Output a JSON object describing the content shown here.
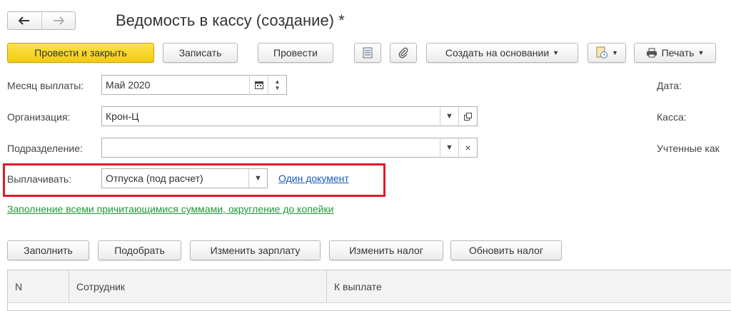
{
  "header": {
    "title": "Ведомость в кассу (создание) *"
  },
  "toolbar": {
    "post_close": "Провести и закрыть",
    "save": "Записать",
    "post": "Провести",
    "create_based": "Создать на основании",
    "print": "Печать"
  },
  "form": {
    "month_label": "Месяц выплаты:",
    "month_value": "Май 2020",
    "org_label": "Организация:",
    "org_value": "Крон-Ц",
    "dept_label": "Подразделение:",
    "dept_value": "",
    "pay_label": "Выплачивать:",
    "pay_value": "Отпуска (под расчет)",
    "one_doc_link": "Один документ",
    "fill_link": "Заполнение всеми причитающимися суммами, округление до копейки",
    "date_label": "Дата:",
    "cash_label": "Касса:",
    "accounted_label": "Учтенные как"
  },
  "actions": {
    "fill": "Заполнить",
    "select": "Подобрать",
    "change_salary": "Изменить зарплату",
    "change_tax": "Изменить налог",
    "update_tax": "Обновить налог"
  },
  "table": {
    "columns": [
      "N",
      "Сотрудник",
      "К выплате"
    ]
  },
  "colors": {
    "primary_button": "#f5d321",
    "highlight_border": "#e3182b",
    "link_blue": "#1a5bb5",
    "link_green": "#1f9a34"
  }
}
